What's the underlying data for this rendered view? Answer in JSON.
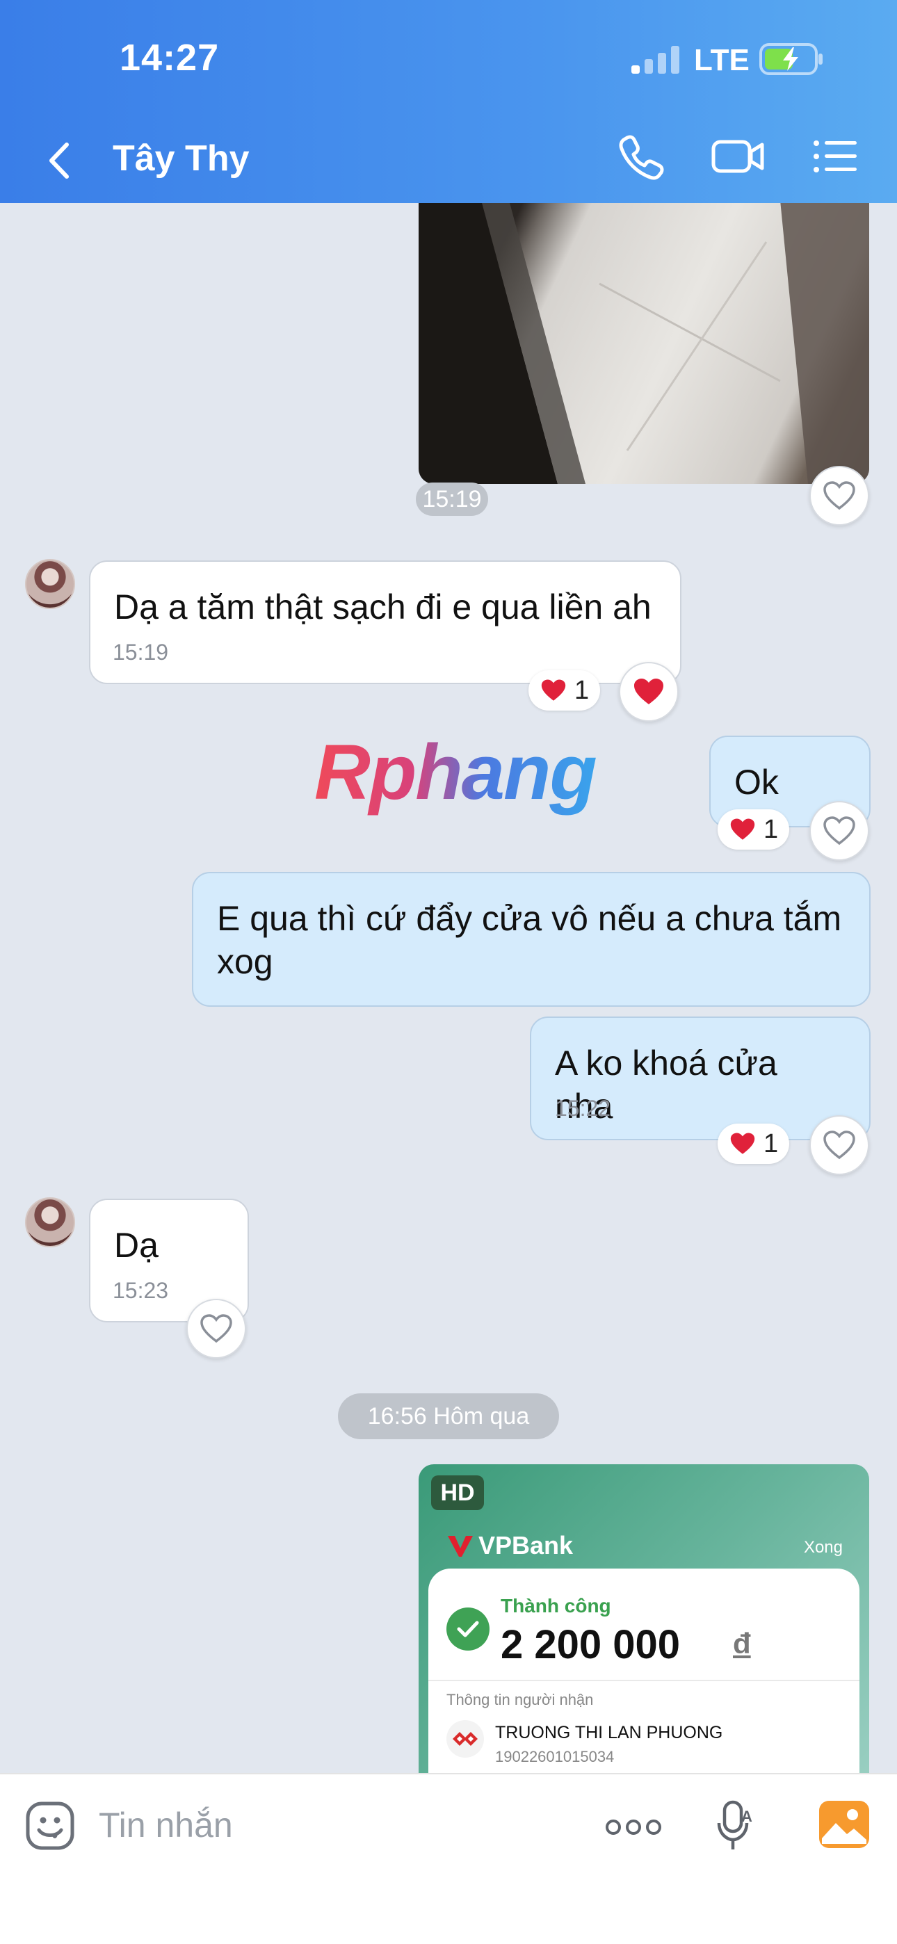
{
  "status_bar": {
    "time": "14:27",
    "network": "LTE"
  },
  "header": {
    "title": "Tây Thy"
  },
  "messages": {
    "img1_time": "15:19",
    "m1_text": "Dạ a tăm thật sạch đi e qua liền ah",
    "m1_time": "15:19",
    "m1_reaction_count": "1",
    "m2_text": "Ok",
    "m2_reaction_count": "1",
    "m3_text": "E qua thì cứ đẩy cửa vô nếu a chưa tắm xog",
    "m4_text": "A ko khoá cửa nha",
    "m4_time": "15:22",
    "m4_reaction_count": "1",
    "m5_text": "Dạ",
    "m5_time": "15:23",
    "date_chip": "16:56 Hôm qua"
  },
  "watermark": "Rphang",
  "receipt": {
    "badge": "HD",
    "bank": "VPBank",
    "done": "Xong",
    "status": "Thành công",
    "amount": "2 200 000",
    "currency": "đ",
    "recipient_label": "Thông tin người nhận",
    "recipient_name": "TRUONG THI LAN PHUONG",
    "recipient_account": "19022601015034"
  },
  "input": {
    "placeholder": "Tin nhắn"
  },
  "colors": {
    "header": "#3a7ee8",
    "outgoing": "#d5ebfc",
    "incoming": "#ffffff",
    "heart": "#e0213a"
  }
}
